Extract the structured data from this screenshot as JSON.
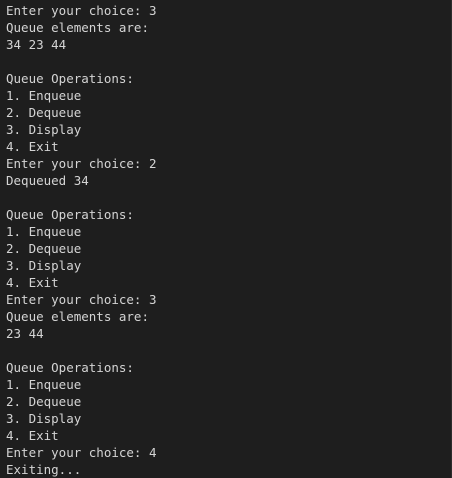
{
  "terminal": {
    "lines": [
      "Enter your choice: 3",
      "Queue elements are:",
      "34 23 44",
      "",
      "Queue Operations:",
      "1. Enqueue",
      "2. Dequeue",
      "3. Display",
      "4. Exit",
      "Enter your choice: 2",
      "Dequeued 34",
      "",
      "Queue Operations:",
      "1. Enqueue",
      "2. Dequeue",
      "3. Display",
      "4. Exit",
      "Enter your choice: 3",
      "Queue elements are:",
      "23 44",
      "",
      "Queue Operations:",
      "1. Enqueue",
      "2. Dequeue",
      "3. Display",
      "4. Exit",
      "Enter your choice: 4",
      "Exiting..."
    ]
  },
  "colors": {
    "background": "#1e1e1e",
    "foreground": "#d4d4d4"
  }
}
